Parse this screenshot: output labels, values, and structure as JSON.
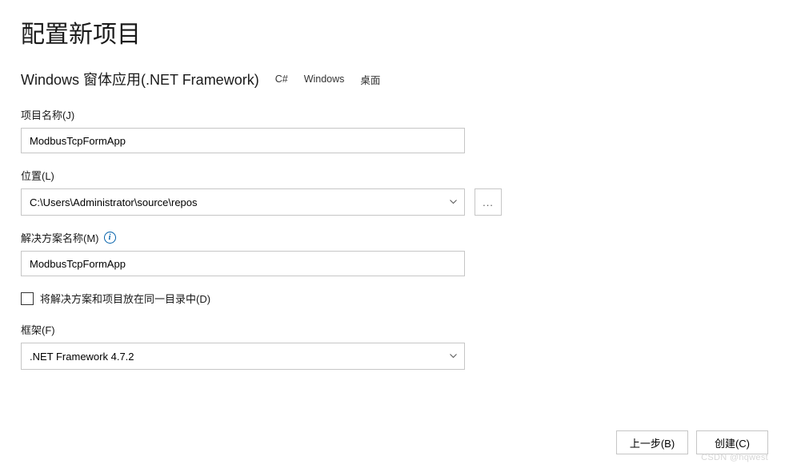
{
  "title": "配置新项目",
  "template": {
    "name": "Windows 窗体应用(.NET Framework)",
    "tags": [
      "C#",
      "Windows",
      "桌面"
    ]
  },
  "fields": {
    "project_name": {
      "label": "项目名称(J)",
      "value": "ModbusTcpFormApp"
    },
    "location": {
      "label": "位置(L)",
      "value": "C:\\Users\\Administrator\\source\\repos",
      "browse_label": "..."
    },
    "solution_name": {
      "label": "解决方案名称(M)",
      "value": "ModbusTcpFormApp"
    },
    "same_dir_checkbox": {
      "label": "将解决方案和项目放在同一目录中(D)",
      "checked": false
    },
    "framework": {
      "label": "框架(F)",
      "value": ".NET Framework 4.7.2"
    }
  },
  "buttons": {
    "back": "上一步(B)",
    "create": "创建(C)"
  },
  "watermark": "CSDN @hqwest"
}
